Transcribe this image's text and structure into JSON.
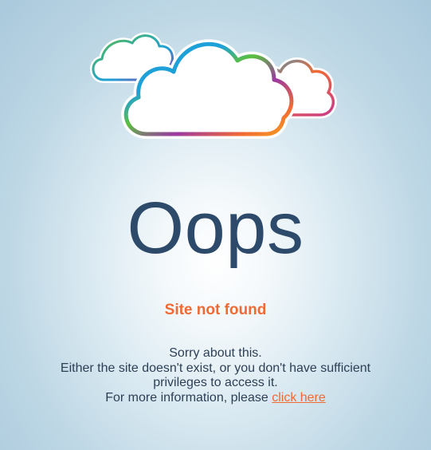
{
  "error": {
    "headline": "Oops",
    "title": "Site not found",
    "apology": "Sorry about this.",
    "reason_line1": "Either the site doesn't exist, or you don't have sufficient",
    "reason_line2": "privileges to access it.",
    "info_prefix": "For more information, please",
    "link_label": "click here"
  },
  "illustration": {
    "icon": "cloud-icon"
  },
  "colors": {
    "headline": "#2d4a6b",
    "accent": "#f06a35",
    "body_text": "#2d3f55",
    "cloud_gradient": [
      "#1ea0d8",
      "#5bbf3f",
      "#9b3aa0",
      "#f06a35"
    ]
  }
}
